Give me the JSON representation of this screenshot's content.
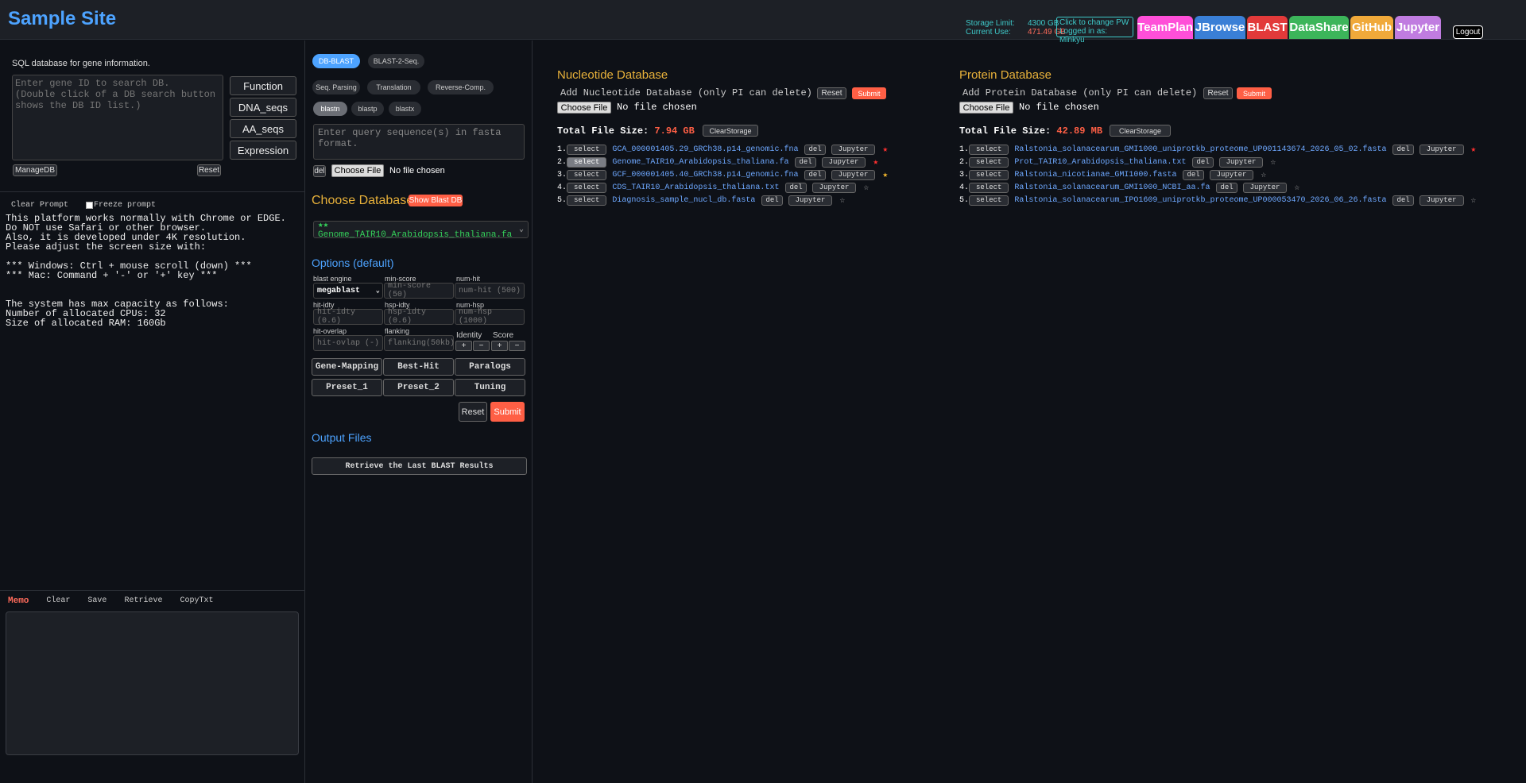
{
  "header": {
    "site_title": "Sample Site",
    "storage_limit_label": "Storage Limit:",
    "storage_limit_value": "4300 GB",
    "current_use_label": "Current Use:",
    "current_use_value": "471.49 GB",
    "change_pw": "Click to change PW",
    "logged_in": "Logged in as: Minkyu",
    "apps": [
      "TeamPlan",
      "JBrowse",
      "BLAST",
      "DataShare",
      "GitHub",
      "Jupyter"
    ],
    "logout": "Logout"
  },
  "left": {
    "sql_title": "SQL database for gene information.",
    "gene_placeholder": "Enter gene ID to search DB.\n(Double click of a DB search button shows the DB ID list.)",
    "buttons": [
      "Function",
      "DNA_seqs",
      "AA_seqs",
      "Expression"
    ],
    "manage_db": "ManageDB",
    "reset": "Reset",
    "clear_prompt": "Clear Prompt",
    "freeze_prompt": "Freeze prompt",
    "prompt_text": "This platform works normally with Chrome or EDGE.\nDo NOT use Safari or other browser.\nAlso, it is developed under 4K resolution.\nPlease adjust the screen size with:\n\n*** Windows: Ctrl + mouse scroll (down) ***\n*** Mac: Command + '-' or '+' key ***\n\n\nThe system has max capacity as follows:\nNumber of allocated CPUs: 32\nSize of allocated RAM: 160Gb",
    "memo": {
      "label": "Memo",
      "clear": "Clear",
      "save": "Save",
      "retrieve": "Retrieve",
      "copy": "CopyTxt"
    }
  },
  "middle": {
    "mode_tabs": [
      "DB-BLAST",
      "BLAST-2-Seq."
    ],
    "tools": [
      "Seq. Parsing",
      "Translation",
      "Reverse-Comp."
    ],
    "programs": [
      "blastn",
      "blastp",
      "blastx"
    ],
    "query_placeholder": "Enter query sequence(s) in fasta format.",
    "del": "del",
    "choose_file": "Choose File",
    "no_file": "No file chosen",
    "choose_db_title": "Choose Database",
    "show_blast_db": "Show Blast DB",
    "selected_db": "★★ Genome_TAIR10_Arabidopsis_thaliana.fa",
    "options_title": "Options (default)",
    "options": {
      "blast_engine_label": "blast engine",
      "blast_engine_value": "megablast",
      "min_score_label": "min-score",
      "min_score_ph": "min-score (50)",
      "num_hit_label": "num-hit",
      "num_hit_ph": "num-hit (500)",
      "hit_idty_label": "hit-idty",
      "hit_idty_ph": "hit-idty (0.6)",
      "hsp_idty_label": "hsp-idty",
      "hsp_idty_ph": "hsp-idty (0.6)",
      "num_hsp_label": "num-hsp",
      "num_hsp_ph": "num-hsp (1000)",
      "hit_overlap_label": "hit-overlap",
      "hit_overlap_ph": "hit-ovlap (-)",
      "flanking_label": "flanking",
      "flanking_ph": "flanking(50kb)",
      "identity_label": "Identity",
      "score_label": "Score",
      "plus": "+",
      "minus": "−"
    },
    "presets": [
      "Gene-Mapping",
      "Best-Hit",
      "Paralogs",
      "Preset_1",
      "Preset_2",
      "Tuning"
    ],
    "reset": "Reset",
    "submit": "Submit",
    "output_title": "Output Files",
    "retrieve_last": "Retrieve the Last BLAST Results"
  },
  "nucleotide": {
    "title": "Nucleotide Database",
    "add_label": "Add Nucleotide Database (only PI can delete)",
    "reset": "Reset",
    "submit": "Submit",
    "choose_file": "Choose File",
    "no_file": "No file chosen",
    "total_label": "Total File Size:",
    "total_value": "7.94 GB",
    "clear_storage": "ClearStorage",
    "files": [
      {
        "num": "1.",
        "name": "GCA_000001405.29_GRCh38.p14_genomic.fna",
        "star": "red",
        "selected": false
      },
      {
        "num": "2.",
        "name": "Genome_TAIR10_Arabidopsis_thaliana.fa",
        "star": "red",
        "selected": true
      },
      {
        "num": "3.",
        "name": "GCF_000001405.40_GRCh38.p14_genomic.fna",
        "star": "gold",
        "selected": false
      },
      {
        "num": "4.",
        "name": "CDS_TAIR10_Arabidopsis_thaliana.txt",
        "star": "empty",
        "selected": false
      },
      {
        "num": "5.",
        "name": "Diagnosis_sample_nucl_db.fasta",
        "star": "empty",
        "selected": false
      }
    ]
  },
  "protein": {
    "title": "Protein Database",
    "add_label": "Add Protein Database (only PI can delete)",
    "reset": "Reset",
    "submit": "Submit",
    "choose_file": "Choose File",
    "no_file": "No file chosen",
    "total_label": "Total File Size:",
    "total_value": "42.89 MB",
    "clear_storage": "ClearStorage",
    "files": [
      {
        "num": "1.",
        "name": "Ralstonia_solanacearum_GMI1000_uniprotkb_proteome_UP001143674_2026_05_02.fasta",
        "star": "red",
        "selected": false
      },
      {
        "num": "2.",
        "name": "Prot_TAIR10_Arabidopsis_thaliana.txt",
        "star": "empty",
        "selected": false
      },
      {
        "num": "3.",
        "name": "Ralstonia_nicotianae_GMI1000.fasta",
        "star": "empty",
        "selected": false
      },
      {
        "num": "4.",
        "name": "Ralstonia_solanacearum_GMI1000_NCBI_aa.fa",
        "star": "empty",
        "selected": false
      },
      {
        "num": "5.",
        "name": "Ralstonia_solanacearum_IPO1609_uniprotkb_proteome_UP000053470_2026_06_26.fasta",
        "star": "empty",
        "selected": false
      }
    ],
    "row_labels": {
      "select": "select",
      "del": "del",
      "jupyter": "Jupyter"
    }
  },
  "colors": {
    "accent_blue": "#4da3ff",
    "gold": "#e8b13a",
    "red": "#ff5f45",
    "apps": [
      "#ff4fd8",
      "#3a7fd6",
      "#e23a3a",
      "#3cb55a",
      "#f0a93a",
      "#c07ce0"
    ]
  }
}
